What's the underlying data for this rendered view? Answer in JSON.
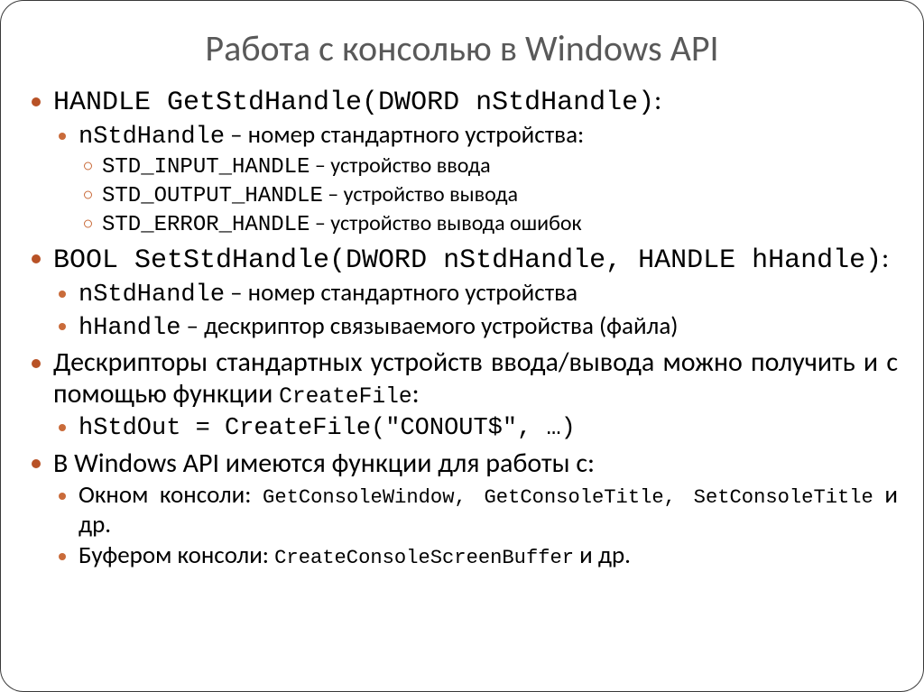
{
  "title": "Работа с консолью в Windows API",
  "l1_item1": {
    "code": "HANDLE GetStdHandle(DWORD nStdHandle)",
    "after": ":"
  },
  "l2_item1_1": {
    "code": "nStdHandle",
    "text": " – номер стандартного устройства:"
  },
  "l3_item1_1_1": {
    "code": "STD_INPUT_HANDLE",
    "text": " – устройство ввода"
  },
  "l3_item1_1_2": {
    "code": "STD_OUTPUT_HANDLE",
    "text": " – устройство вывода"
  },
  "l3_item1_1_3": {
    "code": "STD_ERROR_HANDLE",
    "text": " – устройство вывода ошибок"
  },
  "l1_item2": {
    "code": "BOOL SetStdHandle(DWORD nStdHandle, HANDLE hHandle)",
    "after": ":"
  },
  "l2_item2_1": {
    "code": "nStdHandle",
    "text": " – номер стандартного устройства"
  },
  "l2_item2_2": {
    "code": "hHandle",
    "text": " – дескриптор связываемого устройства (файла)"
  },
  "l1_item3": {
    "text_a": "Дескрипторы стандартных устройств ввода/вывода можно получить и с помощью функции ",
    "code": "CreateFile",
    "after": ":"
  },
  "l2_item3_1": {
    "code": "hStdOut = CreateFile(\"CONOUT$\", …)"
  },
  "l1_item4": {
    "text": "В Windows API имеются функции для работы с:"
  },
  "l2_item4_1": {
    "text_a": "Окном консоли: ",
    "code": "GetConsoleWindow, GetConsoleTitle, SetConsoleTitle",
    "text_b": " и др."
  },
  "l2_item4_2": {
    "text_a": "Буфером консоли: ",
    "code": "CreateConsoleScreenBuffer",
    "text_b": " и др."
  }
}
